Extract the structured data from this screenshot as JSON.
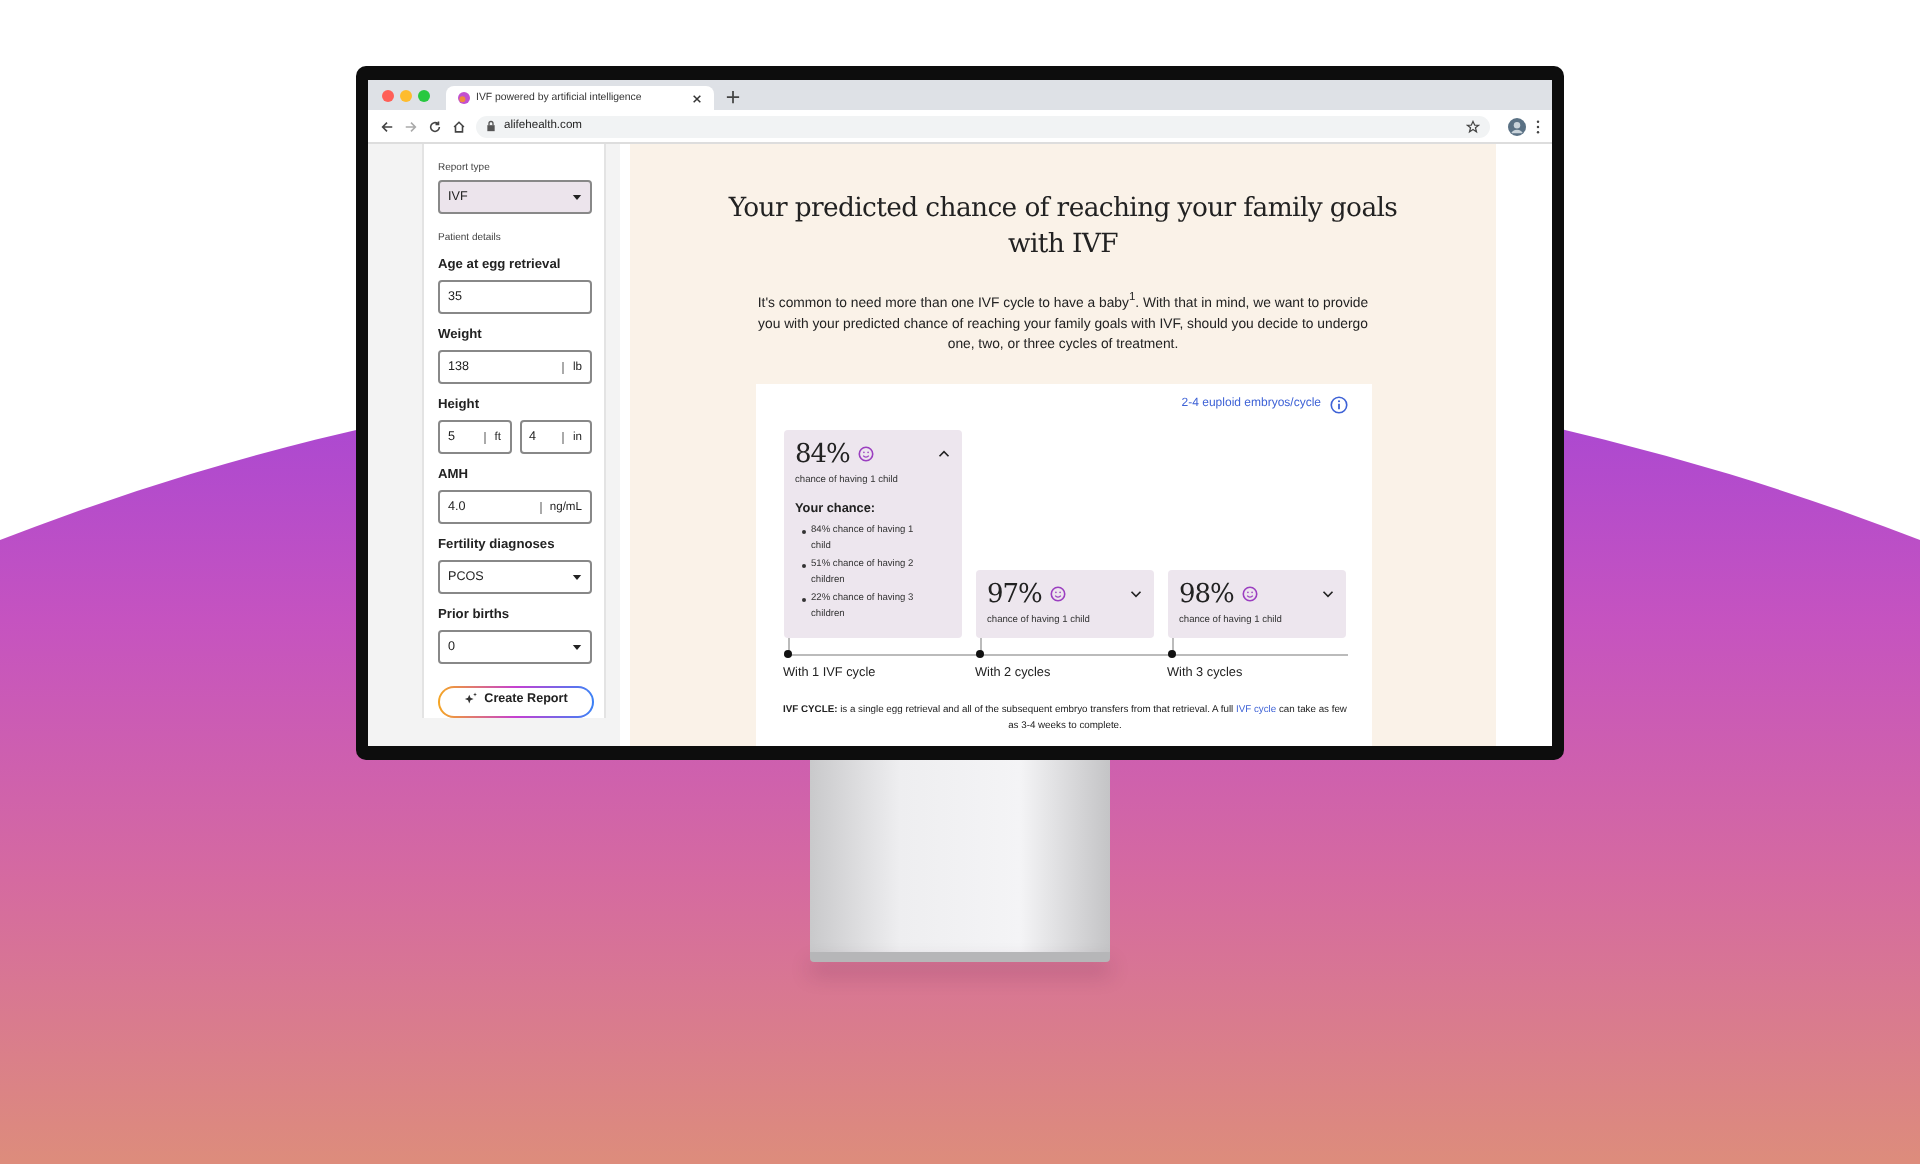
{
  "browser": {
    "tab_title": "IVF powered by artificial intelligence",
    "url": "alifehealth.com"
  },
  "sidebar": {
    "report_type": {
      "label": "Report type",
      "value": "IVF"
    },
    "section_label": "Patient details",
    "fields": [
      {
        "label": "Age at egg retrieval",
        "kind": "input",
        "value": "35"
      },
      {
        "label": "Weight",
        "kind": "unit",
        "value": "138",
        "unit": "lb"
      },
      {
        "label": "Height",
        "kind": "pair",
        "parts": [
          {
            "value": "5",
            "unit": "ft"
          },
          {
            "value": "4",
            "unit": "in"
          }
        ]
      },
      {
        "label": "AMH",
        "kind": "unit",
        "value": "4.0",
        "unit": "ng/mL"
      },
      {
        "label": "Fertility diagnoses",
        "kind": "select",
        "value": "PCOS"
      },
      {
        "label": "Prior births",
        "kind": "select",
        "value": "0"
      }
    ],
    "button": "Create Report"
  },
  "main": {
    "title": "Your predicted chance of reaching your family goals with IVF",
    "intro": "It's common to need more than one IVF cycle to have a baby$^{1}$. With that in mind, we want to provide you with your predicted chance of reaching your family goals with IVF, should you decide to undergo one, two, or three cycles of treatment.",
    "card": {
      "link": "2-4 euploid embryos/cycle",
      "cycles": [
        {
          "percent": "84%",
          "caption": "chance of having 1 child",
          "expanded": true,
          "details_title": "Your chance:",
          "details": [
            "84% chance of having 1 child",
            "51% chance of having 2 children",
            "22% chance of having 3 children"
          ],
          "label": "With 1 IVF cycle"
        },
        {
          "percent": "97%",
          "caption": "chance of having 1 child",
          "expanded": false,
          "label": "With 2 cycles"
        },
        {
          "percent": "98%",
          "caption": "chance of having 1 child",
          "expanded": false,
          "label": "With 3 cycles"
        }
      ],
      "footnote": {
        "before": "**IVF CYCLE:** is a single egg retrieval and all of the subsequent embryo transfers from that retrieval. A full ",
        "link": "IVF cycle",
        "after": " can take as few as 3-4 weeks to complete."
      }
    }
  }
}
